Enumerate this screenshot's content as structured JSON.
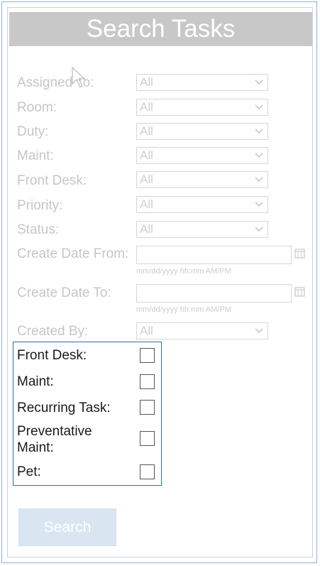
{
  "page": {
    "title": "Search Tasks"
  },
  "form": {
    "assigned_to": {
      "label": "Assigned To:",
      "value": "All"
    },
    "room": {
      "label": "Room:",
      "value": "All"
    },
    "duty": {
      "label": "Duty:",
      "value": "All"
    },
    "maint": {
      "label": "Maint:",
      "value": "All"
    },
    "front_desk": {
      "label": "Front Desk:",
      "value": "All"
    },
    "priority": {
      "label": "Priority:",
      "value": "All"
    },
    "status": {
      "label": "Status:",
      "value": "All"
    },
    "create_date_from": {
      "label": "Create Date From:",
      "value": "",
      "hint": "mm/dd/yyyy hh:mm AM/PM"
    },
    "create_date_to": {
      "label": "Create Date To:",
      "value": "",
      "hint": "mm/dd/yyyy hh:mm AM/PM"
    },
    "created_by": {
      "label": "Created By:",
      "value": "All"
    }
  },
  "checkboxes": {
    "front_desk": {
      "label": "Front Desk:",
      "checked": false
    },
    "maint": {
      "label": "Maint:",
      "checked": false
    },
    "recurring_task": {
      "label": "Recurring Task:",
      "checked": false
    },
    "preventative_maint": {
      "label": "Preventative Maint:",
      "checked": false
    },
    "pet": {
      "label": "Pet:",
      "checked": false
    }
  },
  "actions": {
    "search_label": "Search"
  },
  "colors": {
    "title_bar": "#c8c8c8",
    "disabled_text": "#c6c6c6",
    "group_border": "#2a6fbf",
    "search_button": "#d9e6f2"
  },
  "icons": {
    "select_arrow": "chevron-down-icon",
    "calendar": "calendar-icon"
  }
}
